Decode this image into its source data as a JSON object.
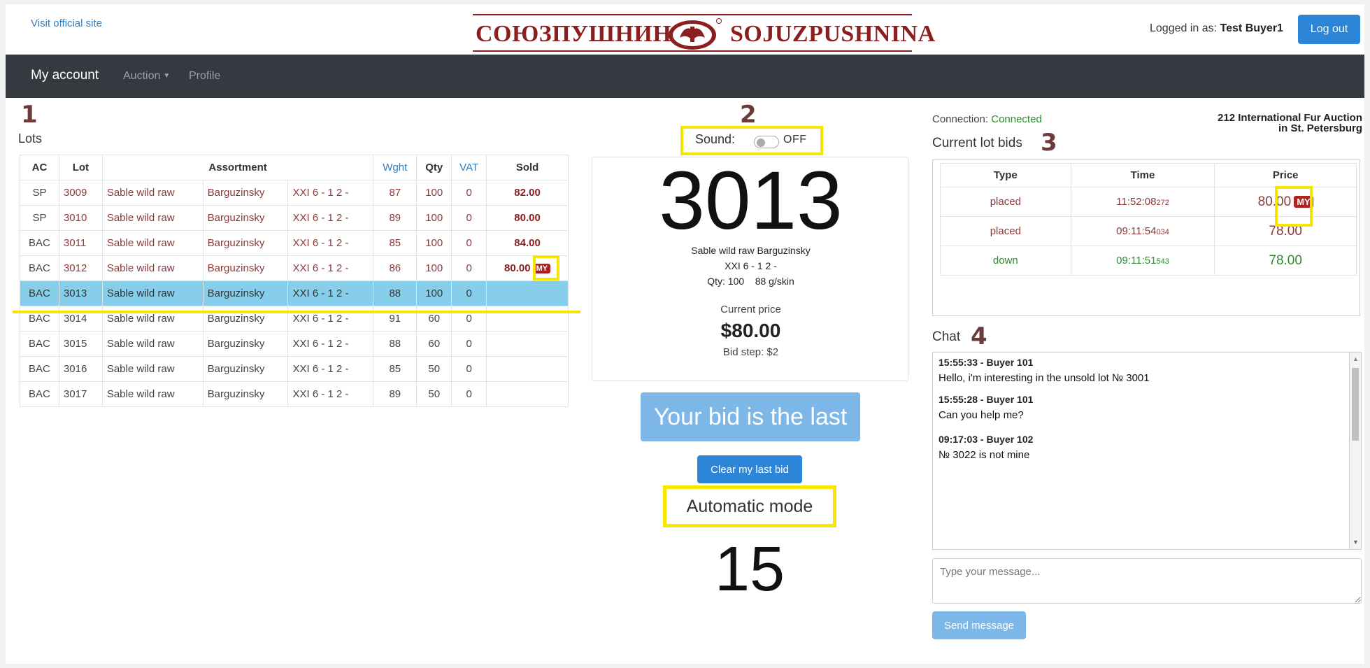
{
  "header": {
    "visit_link": "Visit official site",
    "logo_ru": "СОЮЗПУШНИНА",
    "logo_en": "SOJUZPUSHNINA",
    "logged_in_label": "Logged in as:",
    "user_name": "Test Buyer1",
    "logout": "Log out"
  },
  "nav": {
    "brand": "My account",
    "auction": "Auction",
    "profile": "Profile"
  },
  "annotations": {
    "a1": "1",
    "a2": "2",
    "a3": "3",
    "a4": "4"
  },
  "lots": {
    "title": "Lots",
    "headers": {
      "ac": "AC",
      "lot": "Lot",
      "assortment": "Assortment",
      "wght": "Wght",
      "qty": "Qty",
      "vat": "VAT",
      "sold": "Sold"
    },
    "rows": [
      {
        "ac": "SP",
        "lot": "3009",
        "kind": "Sable wild raw",
        "origin": "Barguzinsky",
        "grade": "XXI 6 - 1 2 -",
        "wght": "87",
        "qty": "100",
        "vat": "0",
        "sold": "82.00",
        "my": ""
      },
      {
        "ac": "SP",
        "lot": "3010",
        "kind": "Sable wild raw",
        "origin": "Barguzinsky",
        "grade": "XXI 6 - 1 2 -",
        "wght": "89",
        "qty": "100",
        "vat": "0",
        "sold": "80.00",
        "my": ""
      },
      {
        "ac": "BAC",
        "lot": "3011",
        "kind": "Sable wild raw",
        "origin": "Barguzinsky",
        "grade": "XXI 6 - 1 2 -",
        "wght": "85",
        "qty": "100",
        "vat": "0",
        "sold": "84.00",
        "my": ""
      },
      {
        "ac": "BAC",
        "lot": "3012",
        "kind": "Sable wild raw",
        "origin": "Barguzinsky",
        "grade": "XXI 6 - 1 2 -",
        "wght": "86",
        "qty": "100",
        "vat": "0",
        "sold": "80.00",
        "my": "MY"
      },
      {
        "ac": "BAC",
        "lot": "3013",
        "kind": "Sable wild raw",
        "origin": "Barguzinsky",
        "grade": "XXI 6 - 1 2 -",
        "wght": "88",
        "qty": "100",
        "vat": "0",
        "sold": "",
        "my": ""
      },
      {
        "ac": "BAC",
        "lot": "3014",
        "kind": "Sable wild raw",
        "origin": "Barguzinsky",
        "grade": "XXI 6 - 1 2 -",
        "wght": "91",
        "qty": "60",
        "vat": "0",
        "sold": "",
        "my": ""
      },
      {
        "ac": "BAC",
        "lot": "3015",
        "kind": "Sable wild raw",
        "origin": "Barguzinsky",
        "grade": "XXI 6 - 1 2 -",
        "wght": "88",
        "qty": "60",
        "vat": "0",
        "sold": "",
        "my": ""
      },
      {
        "ac": "BAC",
        "lot": "3016",
        "kind": "Sable wild raw",
        "origin": "Barguzinsky",
        "grade": "XXI 6 - 1 2 -",
        "wght": "85",
        "qty": "50",
        "vat": "0",
        "sold": "",
        "my": ""
      },
      {
        "ac": "BAC",
        "lot": "3017",
        "kind": "Sable wild raw",
        "origin": "Barguzinsky",
        "grade": "XXI 6 - 1 2 -",
        "wght": "89",
        "qty": "50",
        "vat": "0",
        "sold": "",
        "my": ""
      }
    ]
  },
  "current_lot": {
    "sound_label": "Sound:",
    "sound_state": "OFF",
    "number": "3013",
    "desc_line1": "Sable wild raw Barguzinsky",
    "desc_line2": "XXI 6 - 1 2 -",
    "desc_line3": "Qty: 100    88 g/skin",
    "current_price_label": "Current price",
    "current_price": "$80.00",
    "bid_step": "Bid step: $2",
    "last_bid_button": "Your bid is the last",
    "clear_button": "Clear my last bid",
    "mode": "Automatic mode",
    "countdown": "15"
  },
  "status": {
    "connection_label": "Connection:",
    "connection_value": "Connected",
    "auction_line1": "212 International Fur Auction",
    "auction_line2": "in St. Petersburg"
  },
  "bids": {
    "title": "Current lot bids",
    "headers": {
      "type": "Type",
      "time": "Time",
      "price": "Price"
    },
    "rows": [
      {
        "type": "placed",
        "time": "11:52:08",
        "ms": "272",
        "price": "80.00",
        "my": "MY"
      },
      {
        "type": "placed",
        "time": "09:11:54",
        "ms": "034",
        "price": "78.00",
        "my": ""
      },
      {
        "type": "down",
        "time": "09:11:51",
        "ms": "543",
        "price": "78.00",
        "my": ""
      }
    ]
  },
  "chat": {
    "title": "Chat",
    "messages": [
      {
        "header": "15:55:33 - Buyer 101",
        "text": "Hello, i'm interesting in the unsold lot № 3001"
      },
      {
        "header": "15:55:28 - Buyer 101",
        "text": "Can you help me?"
      },
      {
        "header": "09:17:03 - Buyer 102",
        "text": "№ 3022 is not mine"
      }
    ],
    "placeholder": "Type your message...",
    "send": "Send message"
  },
  "colors": {
    "brand": "#8b1f1f",
    "primary": "#2c85d6",
    "primary_light": "#7db7e8",
    "navbar": "#343a40",
    "highlight": "#f5e500",
    "active_row": "#87ceeb",
    "connected": "#2e8b2e"
  }
}
